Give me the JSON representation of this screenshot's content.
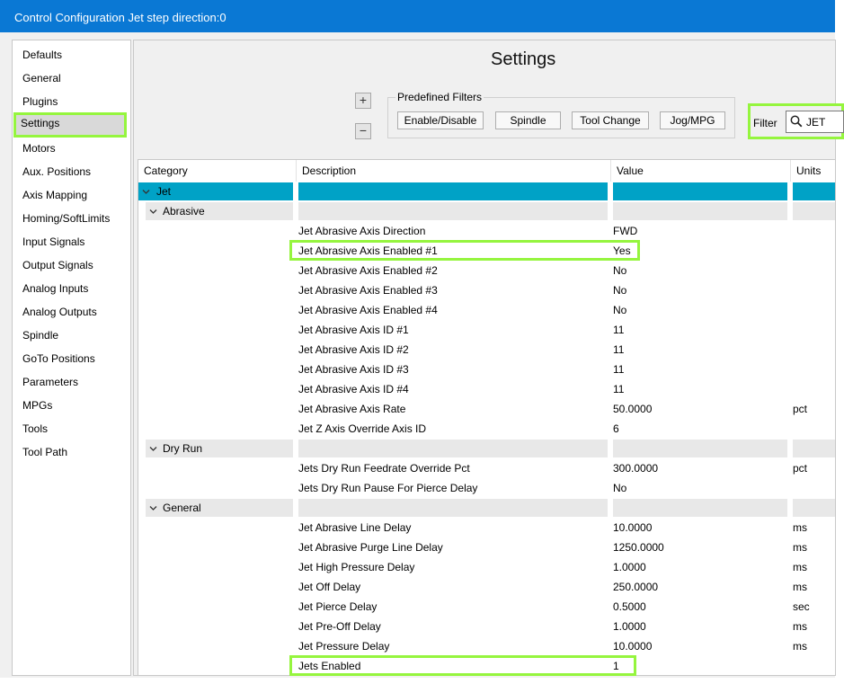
{
  "window": {
    "title": "Control Configuration Jet step direction:0"
  },
  "sidebar": {
    "items": [
      {
        "label": "Defaults"
      },
      {
        "label": "General"
      },
      {
        "label": "Plugins"
      },
      {
        "label": "Settings"
      },
      {
        "label": "Motors"
      },
      {
        "label": "Aux. Positions"
      },
      {
        "label": "Axis Mapping"
      },
      {
        "label": "Homing/SoftLimits"
      },
      {
        "label": "Input Signals"
      },
      {
        "label": "Output Signals"
      },
      {
        "label": "Analog Inputs"
      },
      {
        "label": "Analog Outputs"
      },
      {
        "label": "Spindle"
      },
      {
        "label": "GoTo Positions"
      },
      {
        "label": "Parameters"
      },
      {
        "label": "MPGs"
      },
      {
        "label": "Tools"
      },
      {
        "label": "Tool Path"
      }
    ],
    "selected": "Settings"
  },
  "main": {
    "title": "Settings",
    "expand_symbol": "+",
    "collapse_symbol": "−",
    "predefined_filters": {
      "label": "Predefined Filters",
      "buttons": [
        "Enable/Disable",
        "Spindle",
        "Tool Change",
        "Jog/MPG"
      ]
    },
    "filter": {
      "label": "Filter",
      "value": "JET"
    }
  },
  "grid": {
    "columns": [
      "Category",
      "Description",
      "Value",
      "Units"
    ],
    "root": "Jet",
    "groups": [
      {
        "name": "Abrasive",
        "rows": [
          {
            "description": "Jet Abrasive Axis Direction",
            "value": "FWD",
            "units": ""
          },
          {
            "description": "Jet Abrasive Axis Enabled #1",
            "value": "Yes",
            "units": ""
          },
          {
            "description": "Jet Abrasive Axis Enabled #2",
            "value": "No",
            "units": ""
          },
          {
            "description": "Jet Abrasive Axis Enabled #3",
            "value": "No",
            "units": ""
          },
          {
            "description": "Jet Abrasive Axis Enabled #4",
            "value": "No",
            "units": ""
          },
          {
            "description": "Jet Abrasive Axis ID #1",
            "value": "11",
            "units": ""
          },
          {
            "description": "Jet Abrasive Axis ID #2",
            "value": "11",
            "units": ""
          },
          {
            "description": "Jet Abrasive Axis ID #3",
            "value": "11",
            "units": ""
          },
          {
            "description": "Jet Abrasive Axis ID #4",
            "value": "11",
            "units": ""
          },
          {
            "description": "Jet Abrasive Axis Rate",
            "value": "50.0000",
            "units": "pct"
          },
          {
            "description": "Jet Z Axis Override Axis ID",
            "value": "6",
            "units": ""
          }
        ]
      },
      {
        "name": "Dry Run",
        "rows": [
          {
            "description": "Jets Dry Run Feedrate Override Pct",
            "value": "300.0000",
            "units": "pct"
          },
          {
            "description": "Jets Dry Run Pause For Pierce Delay",
            "value": "No",
            "units": ""
          }
        ]
      },
      {
        "name": "General",
        "rows": [
          {
            "description": "Jet Abrasive Line Delay",
            "value": "10.0000",
            "units": "ms"
          },
          {
            "description": "Jet Abrasive Purge Line Delay",
            "value": "1250.0000",
            "units": "ms"
          },
          {
            "description": "Jet High Pressure Delay",
            "value": "1.0000",
            "units": "ms"
          },
          {
            "description": "Jet Off Delay",
            "value": "250.0000",
            "units": "ms"
          },
          {
            "description": "Jet Pierce Delay",
            "value": "0.5000",
            "units": "sec"
          },
          {
            "description": "Jet Pre-Off Delay",
            "value": "1.0000",
            "units": "ms"
          },
          {
            "description": "Jet Pressure Delay",
            "value": "10.0000",
            "units": "ms"
          },
          {
            "description": "Jets Enabled",
            "value": "1",
            "units": ""
          }
        ]
      }
    ]
  },
  "colors": {
    "titlebar": "#0a78d4",
    "selected_band": "#00a2c6",
    "group_band": "#e8e8e8",
    "highlight": "#95f53e"
  }
}
